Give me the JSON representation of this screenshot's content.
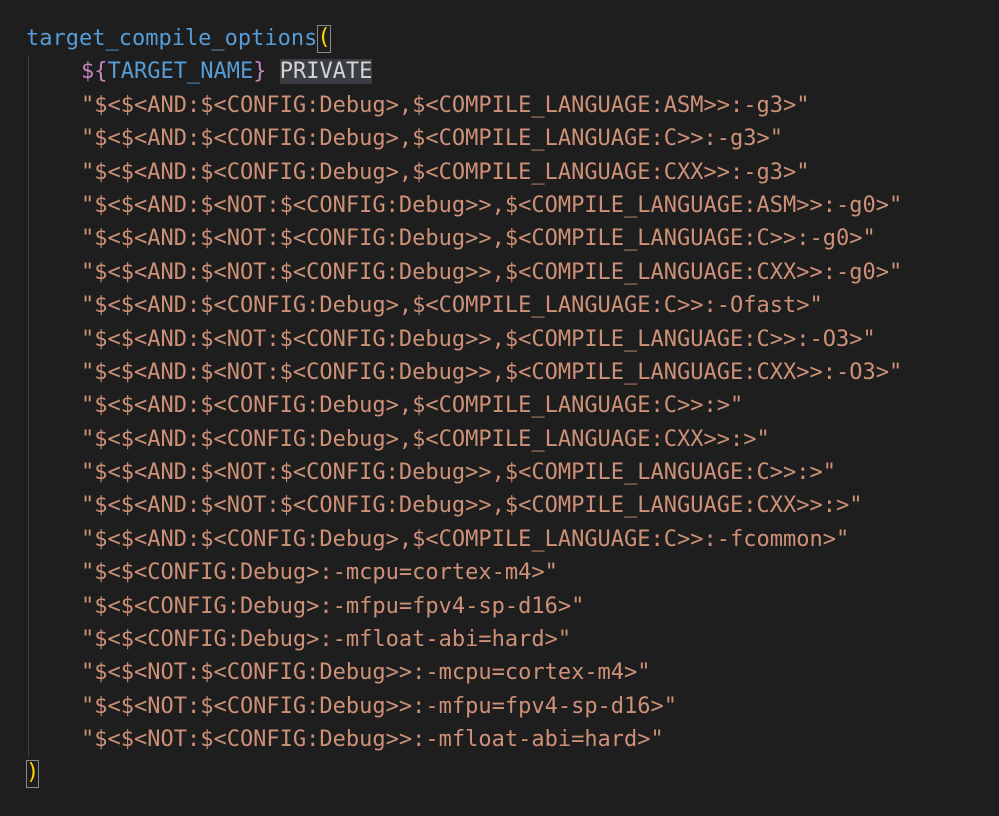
{
  "editor": {
    "function_name": "target_compile_options",
    "open_paren": "(",
    "close_paren": ")",
    "var_open": "${",
    "var_name": "TARGET_NAME",
    "var_close": "}",
    "keyword": "PRIVATE",
    "args": [
      "\"$<$<AND:$<CONFIG:Debug>,$<COMPILE_LANGUAGE:ASM>>:-g3>\"",
      "\"$<$<AND:$<CONFIG:Debug>,$<COMPILE_LANGUAGE:C>>:-g3>\"",
      "\"$<$<AND:$<CONFIG:Debug>,$<COMPILE_LANGUAGE:CXX>>:-g3>\"",
      "\"$<$<AND:$<NOT:$<CONFIG:Debug>>,$<COMPILE_LANGUAGE:ASM>>:-g0>\"",
      "\"$<$<AND:$<NOT:$<CONFIG:Debug>>,$<COMPILE_LANGUAGE:C>>:-g0>\"",
      "\"$<$<AND:$<NOT:$<CONFIG:Debug>>,$<COMPILE_LANGUAGE:CXX>>:-g0>\"",
      "\"$<$<AND:$<CONFIG:Debug>,$<COMPILE_LANGUAGE:C>>:-Ofast>\"",
      "\"$<$<AND:$<NOT:$<CONFIG:Debug>>,$<COMPILE_LANGUAGE:C>>:-O3>\"",
      "\"$<$<AND:$<NOT:$<CONFIG:Debug>>,$<COMPILE_LANGUAGE:CXX>>:-O3>\"",
      "\"$<$<AND:$<CONFIG:Debug>,$<COMPILE_LANGUAGE:C>>:>\"",
      "\"$<$<AND:$<CONFIG:Debug>,$<COMPILE_LANGUAGE:CXX>>:>\"",
      "\"$<$<AND:$<NOT:$<CONFIG:Debug>>,$<COMPILE_LANGUAGE:C>>:>\"",
      "\"$<$<AND:$<NOT:$<CONFIG:Debug>>,$<COMPILE_LANGUAGE:CXX>>:>\"",
      "\"$<$<AND:$<CONFIG:Debug>,$<COMPILE_LANGUAGE:C>>:-fcommon>\"",
      "\"$<$<CONFIG:Debug>:-mcpu=cortex-m4>\"",
      "\"$<$<CONFIG:Debug>:-mfpu=fpv4-sp-d16>\"",
      "\"$<$<CONFIG:Debug>:-mfloat-abi=hard>\"",
      "\"$<$<NOT:$<CONFIG:Debug>>:-mcpu=cortex-m4>\"",
      "\"$<$<NOT:$<CONFIG:Debug>>:-mfpu=fpv4-sp-d16>\"",
      "\"$<$<NOT:$<CONFIG:Debug>>:-mfloat-abi=hard>\""
    ]
  },
  "colors": {
    "background": "#1e1e1e",
    "function": "#569cd6",
    "string": "#ce9178",
    "variable_brace": "#c586c0",
    "variable_name": "#569cd6",
    "bracket_match": "#ffd700"
  }
}
